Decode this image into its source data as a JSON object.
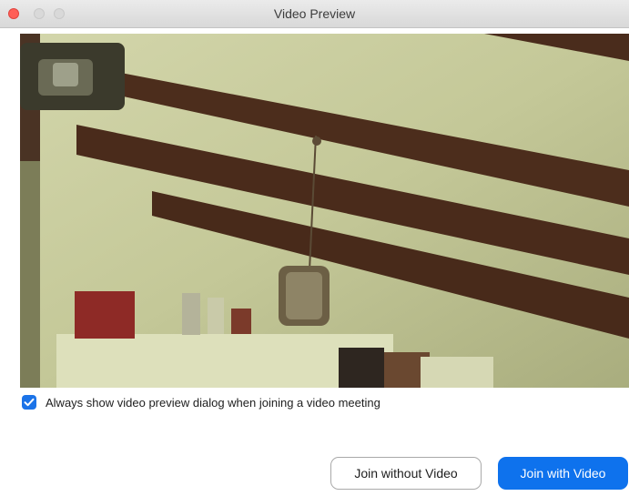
{
  "window": {
    "title": "Video Preview"
  },
  "options": {
    "always_show_preview": {
      "label": "Always show video preview dialog when joining a video meeting",
      "checked": true
    }
  },
  "actions": {
    "join_without_video": "Join without Video",
    "join_with_video": "Join with Video"
  },
  "colors": {
    "accent": "#0e72ed",
    "checkbox": "#1b73e8",
    "close": "#ff5f57"
  }
}
